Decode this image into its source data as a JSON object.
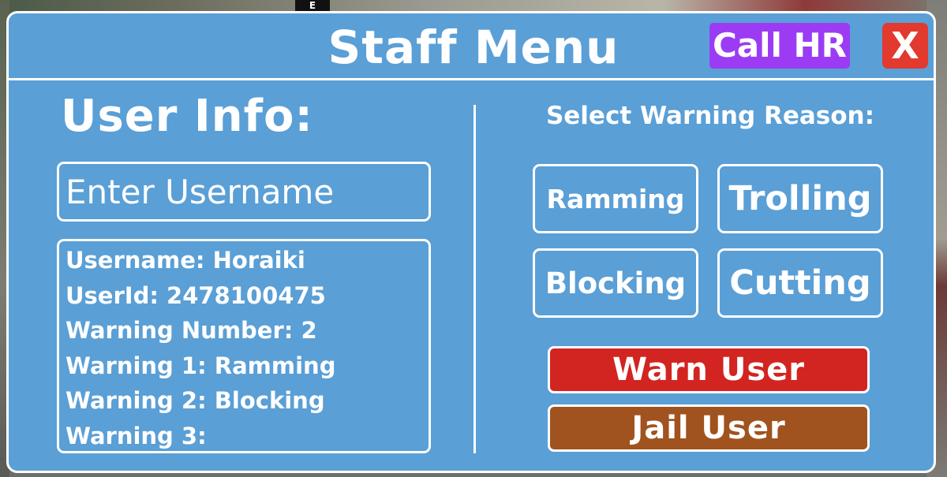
{
  "background": {
    "sign_text": "E"
  },
  "panel": {
    "title": "Staff Menu",
    "call_hr_label": "Call HR",
    "close_label": "X",
    "colors": {
      "panel_bg": "#5a9fd6",
      "call_hr": "#9b3cf4",
      "close": "#e23a2e",
      "warn": "#d22420",
      "jail": "#a0531e"
    }
  },
  "user_info": {
    "heading": "User Info:",
    "input_placeholder": "Enter Username",
    "input_value": "",
    "lines": [
      "Username: Horaiki",
      "UserId: 2478100475",
      "Warning Number: 2",
      "Warning 1: Ramming",
      "Warning 2: Blocking",
      "Warning 3:"
    ]
  },
  "warning": {
    "heading": "Select Warning Reason:",
    "reasons": [
      "Ramming",
      "Trolling",
      "Blocking",
      "Cutting"
    ],
    "warn_label": "Warn User",
    "jail_label": "Jail User"
  }
}
